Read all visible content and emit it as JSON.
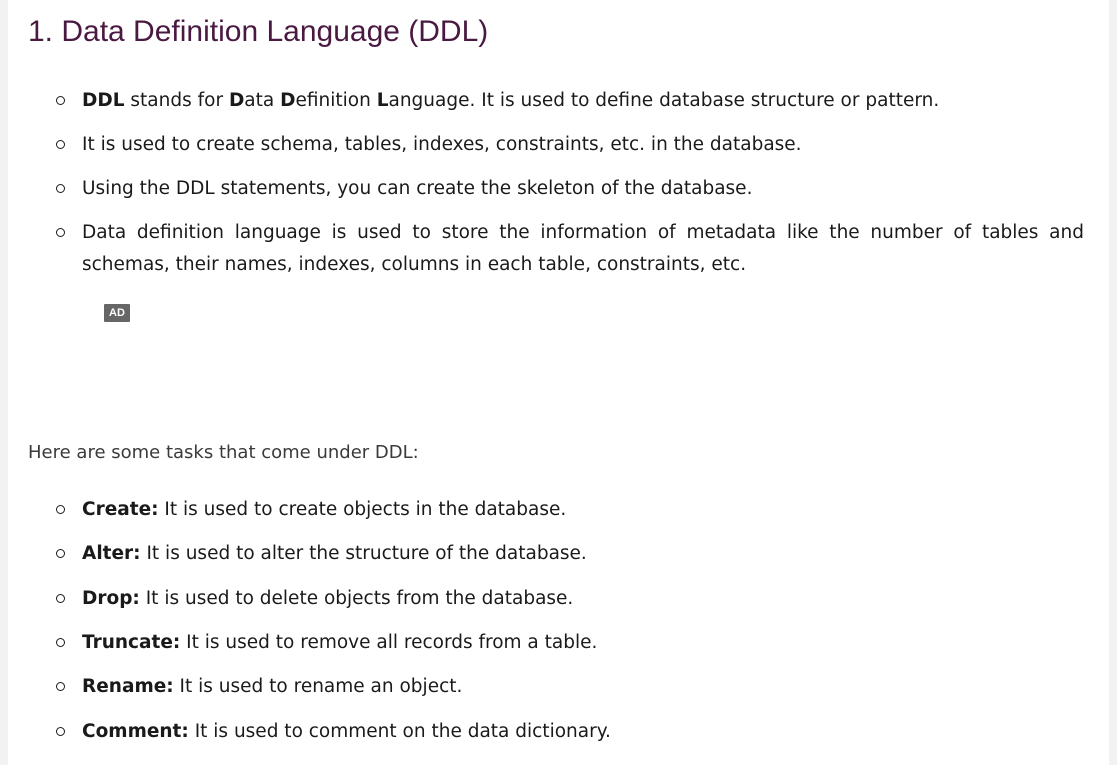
{
  "heading": "1. Data Definition Language (DDL)",
  "ddl_points": {
    "p1": {
      "ddl": "DDL",
      "stands_for": " stands for ",
      "d": "D",
      "ata": "ata ",
      "d2": "D",
      "efinition": "efinition ",
      "l": "L",
      "rest": "anguage. It is used to define database structure or pattern."
    },
    "p2": "It is used to create schema, tables, indexes, constraints, etc. in the database.",
    "p3": "Using the DDL statements, you can create the skeleton of the database.",
    "p4": "Data definition language is used to store the information of metadata like the number of tables and schemas, their names, indexes, columns in each table, constraints, etc."
  },
  "ad_label": "AD",
  "intro": "Here are some tasks that come under DDL:",
  "tasks": [
    {
      "term": "Create:",
      "desc": " It is used to create objects in the database."
    },
    {
      "term": "Alter:",
      "desc": " It is used to alter the structure of the database."
    },
    {
      "term": "Drop:",
      "desc": " It is used to delete objects from the database."
    },
    {
      "term": "Truncate:",
      "desc": " It is used to remove all records from a table."
    },
    {
      "term": "Rename:",
      "desc": " It is used to rename an object."
    },
    {
      "term": "Comment:",
      "desc": " It is used to comment on the data dictionary."
    }
  ]
}
